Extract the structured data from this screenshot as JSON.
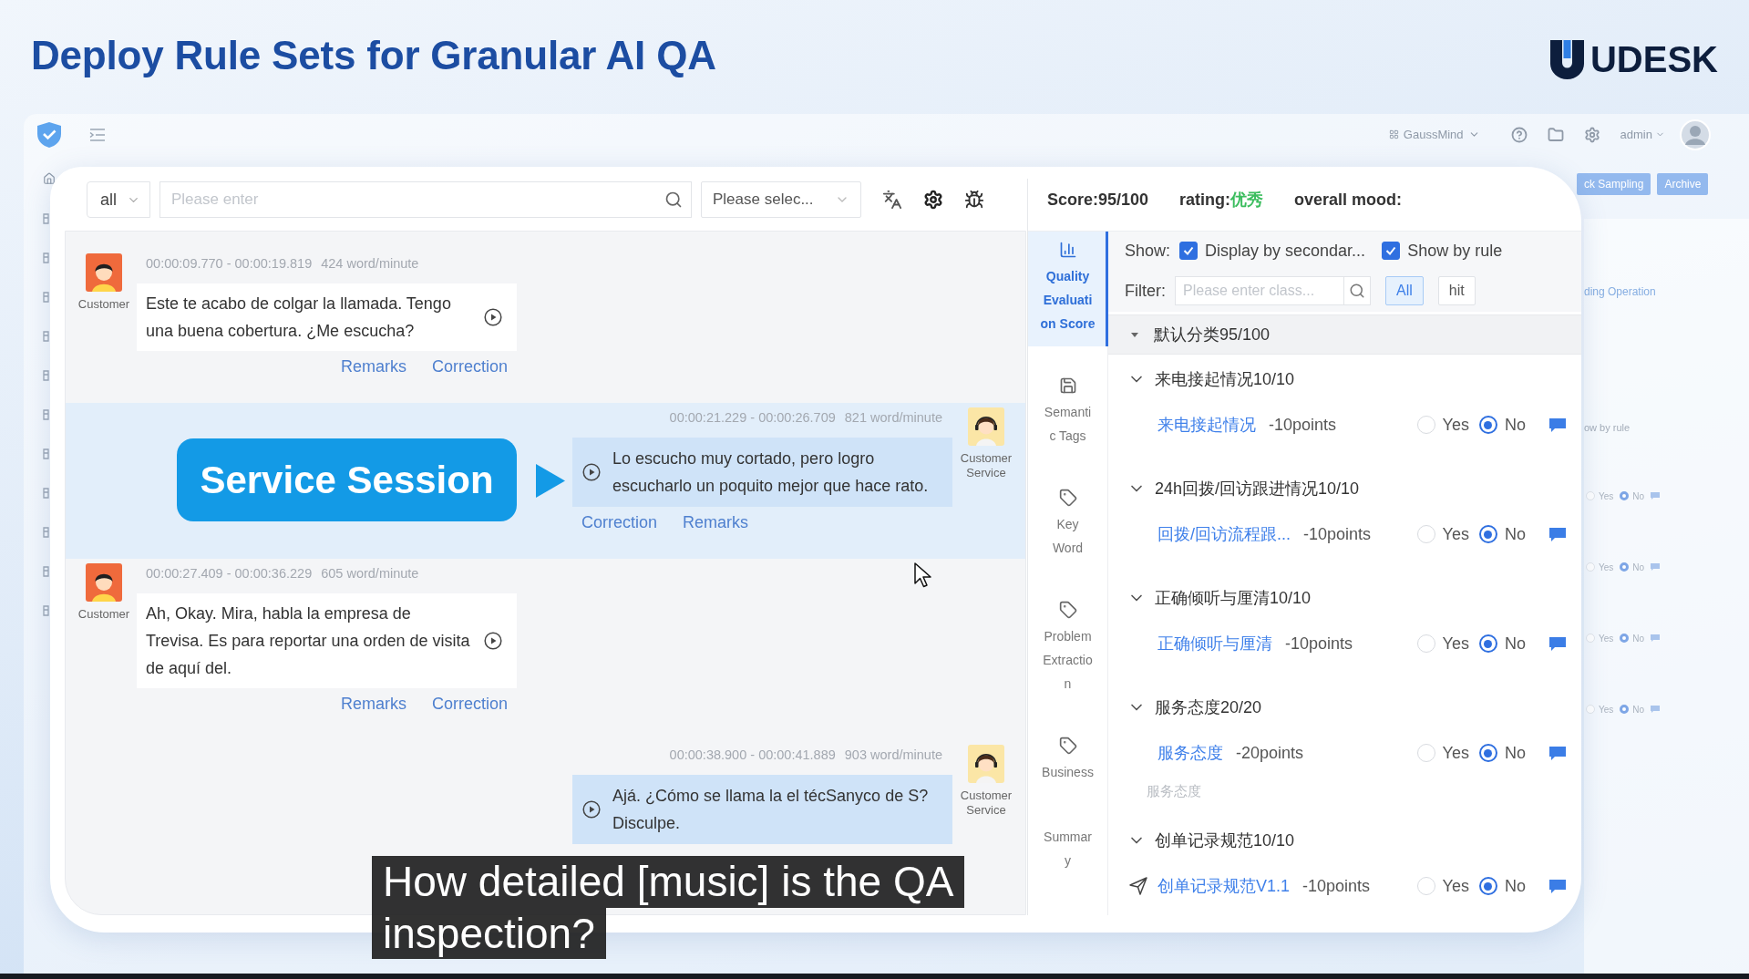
{
  "slide": {
    "title": "Deploy Rule Sets for Granular AI QA",
    "brand": "UDESK"
  },
  "background_app": {
    "workspace": "GaussMind",
    "user": "admin",
    "actions": [
      "ck Sampling",
      "Archive"
    ],
    "side_panel": {
      "cut_link": "ding Operation",
      "cut_label": "ow by rule",
      "rows": [
        {
          "options": [
            {
              "label": "Yes",
              "selected": false
            },
            {
              "label": "No",
              "selected": true
            }
          ]
        },
        {
          "options": [
            {
              "label": "Yes",
              "selected": false
            },
            {
              "label": "No",
              "selected": true
            }
          ]
        },
        {
          "options": [
            {
              "label": "Yes",
              "selected": false
            },
            {
              "label": "No",
              "selected": true
            }
          ]
        },
        {
          "options": [
            {
              "label": "Yes",
              "selected": false
            },
            {
              "label": "No",
              "selected": true
            }
          ]
        }
      ]
    }
  },
  "toolbar": {
    "scope": "all",
    "search": {
      "placeholder": "Please enter"
    },
    "select": {
      "placeholder": "Please selec..."
    }
  },
  "messages": [
    {
      "kind": "customer",
      "speaker": "Customer",
      "time": "00:00:09.770 - 00:00:19.819",
      "rate": "424 word/minute",
      "text": "Este te acabo de colgar la llamada. Tengo una buena cobertura. ¿Me escucha?",
      "actions": [
        "Remarks",
        "Correction"
      ],
      "highlighted": false
    },
    {
      "kind": "agent",
      "speaker": "Customer Service",
      "time": "00:00:21.229 - 00:00:26.709",
      "rate": "821 word/minute",
      "text": "Lo escucho muy cortado, pero logro escucharlo un poquito mejor que hace rato.",
      "actions": [
        "Correction",
        "Remarks"
      ],
      "highlighted": true,
      "callout": "Service Session"
    },
    {
      "kind": "customer",
      "speaker": "Customer",
      "time": "00:00:27.409 - 00:00:36.229",
      "rate": "605 word/minute",
      "text": "Ah, Okay. Mira, habla la empresa de Trevisa. Es para reportar una orden de visita de aquí del.",
      "actions": [
        "Remarks",
        "Correction"
      ],
      "highlighted": false
    },
    {
      "kind": "agent",
      "speaker": "Customer Service",
      "time": "00:00:38.900 - 00:00:41.889",
      "rate": "903 word/minute",
      "text": "Ajá. ¿Cómo se llama la el técSanyco de S? Disculpe.",
      "highlighted": false
    }
  ],
  "score_bar": {
    "score": "Score:95/100",
    "rating_label": "rating:",
    "rating_value": "优秀",
    "mood": "overall mood:"
  },
  "side_tabs": [
    {
      "label": "Quality Evaluation Score",
      "selected": true
    },
    {
      "label": "Semantic Tags",
      "selected": false
    },
    {
      "label": "Key Word",
      "selected": false
    },
    {
      "label": "Problem Extraction",
      "selected": false
    },
    {
      "label": "Business",
      "selected": false
    },
    {
      "label": "Summary",
      "selected": false
    }
  ],
  "show_options": {
    "label": "Show:",
    "options": [
      {
        "label": "Display by secondar...",
        "checked": true
      },
      {
        "label": "Show by rule",
        "checked": true
      }
    ]
  },
  "filter": {
    "label": "Filter:",
    "placeholder": "Please enter class...",
    "buttons": [
      {
        "label": "All",
        "selected": true
      },
      {
        "label": "hit",
        "selected": false
      }
    ]
  },
  "category": {
    "title": "默认分类95/100",
    "expanded": true
  },
  "groups": [
    {
      "title": "来电接起情况10/10",
      "expanded": true,
      "items": [
        {
          "kind": "plain",
          "name": "来电接起情况",
          "points": "-10points",
          "options": [
            {
              "label": "Yes",
              "selected": false
            },
            {
              "label": "No",
              "selected": true
            }
          ]
        }
      ]
    },
    {
      "title": "24h回拨/回访跟进情况10/10",
      "expanded": true,
      "items": [
        {
          "kind": "plain",
          "name": "回拨/回访流程跟...",
          "points": "-10points",
          "options": [
            {
              "label": "Yes",
              "selected": false
            },
            {
              "label": "No",
              "selected": true
            }
          ]
        }
      ]
    },
    {
      "title": "正确倾听与厘清10/10",
      "expanded": true,
      "items": [
        {
          "kind": "plain",
          "name": "正确倾听与厘清",
          "points": "-10points",
          "options": [
            {
              "label": "Yes",
              "selected": false
            },
            {
              "label": "No",
              "selected": true
            }
          ]
        }
      ]
    },
    {
      "title": "服务态度20/20",
      "expanded": true,
      "items": [
        {
          "kind": "plain",
          "name": "服务态度",
          "points": "-20points",
          "note": "服务态度",
          "options": [
            {
              "label": "Yes",
              "selected": false
            },
            {
              "label": "No",
              "selected": true
            }
          ]
        }
      ]
    },
    {
      "title": "创单记录规范10/10",
      "expanded": true,
      "items": [
        {
          "kind": "marked",
          "name": "创单记录规范V1.1",
          "points": "-10points",
          "options": [
            {
              "label": "Yes",
              "selected": false
            },
            {
              "label": "No",
              "selected": true
            }
          ]
        }
      ]
    }
  ],
  "subtitle_lines": [
    "How detailed [music] is the QA",
    "inspection?"
  ]
}
